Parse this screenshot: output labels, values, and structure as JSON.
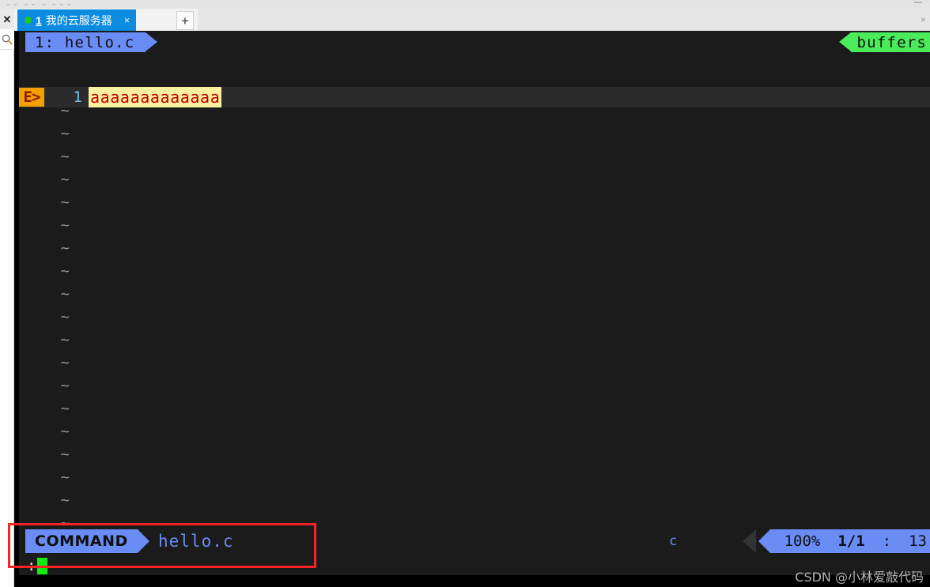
{
  "window": {
    "chrome_ghost_text": "⌄⌄  ⌄⌄ ⌄  ⌄⌄⌄",
    "close_icon": "×",
    "minimize_icon": "—"
  },
  "sidebar": {
    "items": [
      {
        "name": "close",
        "icon": "×",
        "glyph": "✕"
      },
      {
        "name": "search",
        "icon": "search-icon",
        "glyph": "🔍"
      }
    ]
  },
  "tabbar": {
    "active_tab": {
      "index": "1",
      "title": "我的云服务器",
      "close_label": "×",
      "status_color": "#22c722"
    },
    "new_tab_label": "+",
    "window_close_label": "×"
  },
  "editor": {
    "tabline": {
      "buffer_label": "1: hello.c",
      "buffers_label": "buffers",
      "buffer_color": "#6a8cf5",
      "buffers_color": "#4aec5a"
    },
    "sign_column": "E>",
    "line_number": "1",
    "line_text": "aaaaaaaaaaaaa",
    "line_text_bg": "#fbf0a0",
    "line_text_fg": "#c00000",
    "empty_line_marker": "~",
    "empty_line_count": 20
  },
  "statusline": {
    "mode": "COMMAND",
    "file_name": "hello.c",
    "file_type": "c",
    "percent": "100%",
    "line_pos": "1/1",
    "separator": ":",
    "column": "13",
    "accent_color": "#6a8cf5"
  },
  "cmdline": {
    "prompt": ":",
    "value": "",
    "cursor_color": "#15ea15"
  },
  "watermark": {
    "text": "CSDN @小林爱敲代码"
  },
  "annotation": {
    "color": "#fb2323"
  }
}
